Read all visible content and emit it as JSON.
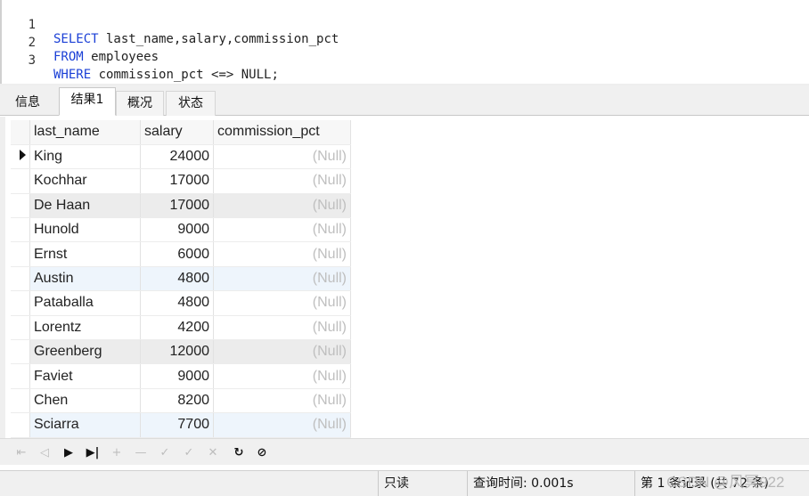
{
  "editor": {
    "lines": [
      {
        "num": "1",
        "kw": "SELECT",
        "rest": " last_name,salary,commission_pct"
      },
      {
        "num": "2",
        "kw": "FROM",
        "rest": " employees"
      },
      {
        "num": "3",
        "kw": "WHERE",
        "rest": " commission_pct <=> NULL;"
      }
    ]
  },
  "tabs": [
    "信息",
    "结果1",
    "概况",
    "状态"
  ],
  "active_tab": "结果1",
  "grid": {
    "columns": [
      "last_name",
      "salary",
      "commission_pct"
    ],
    "rows": [
      {
        "last_name": "King",
        "salary": "24000",
        "commission_pct": "(Null)"
      },
      {
        "last_name": "Kochhar",
        "salary": "17000",
        "commission_pct": "(Null)"
      },
      {
        "last_name": "De Haan",
        "salary": "17000",
        "commission_pct": "(Null)"
      },
      {
        "last_name": "Hunold",
        "salary": "9000",
        "commission_pct": "(Null)"
      },
      {
        "last_name": "Ernst",
        "salary": "6000",
        "commission_pct": "(Null)"
      },
      {
        "last_name": "Austin",
        "salary": "4800",
        "commission_pct": "(Null)"
      },
      {
        "last_name": "Pataballa",
        "salary": "4800",
        "commission_pct": "(Null)"
      },
      {
        "last_name": "Lorentz",
        "salary": "4200",
        "commission_pct": "(Null)"
      },
      {
        "last_name": "Greenberg",
        "salary": "12000",
        "commission_pct": "(Null)"
      },
      {
        "last_name": "Faviet",
        "salary": "9000",
        "commission_pct": "(Null)"
      },
      {
        "last_name": "Chen",
        "salary": "8200",
        "commission_pct": "(Null)"
      },
      {
        "last_name": "Sciarra",
        "salary": "7700",
        "commission_pct": "(Null)"
      }
    ]
  },
  "navbar": {
    "first": "⇤",
    "prev": "◁",
    "next": "▶",
    "last": "▶|",
    "add": "+",
    "delete": "—",
    "apply": "✓",
    "cancel": "✕",
    "refresh": "↻",
    "stop": "⊘"
  },
  "status": {
    "mode": "只读",
    "query_time": "查询时间: 0.001s",
    "record_info": "第 1 条记录 (共 72 条)"
  },
  "watermark": "CSDN @风冥922",
  "colors": {
    "keyword": "#1a3fd6",
    "null_text": "#bfbfbf",
    "selected_header": "#dbe8f6"
  }
}
